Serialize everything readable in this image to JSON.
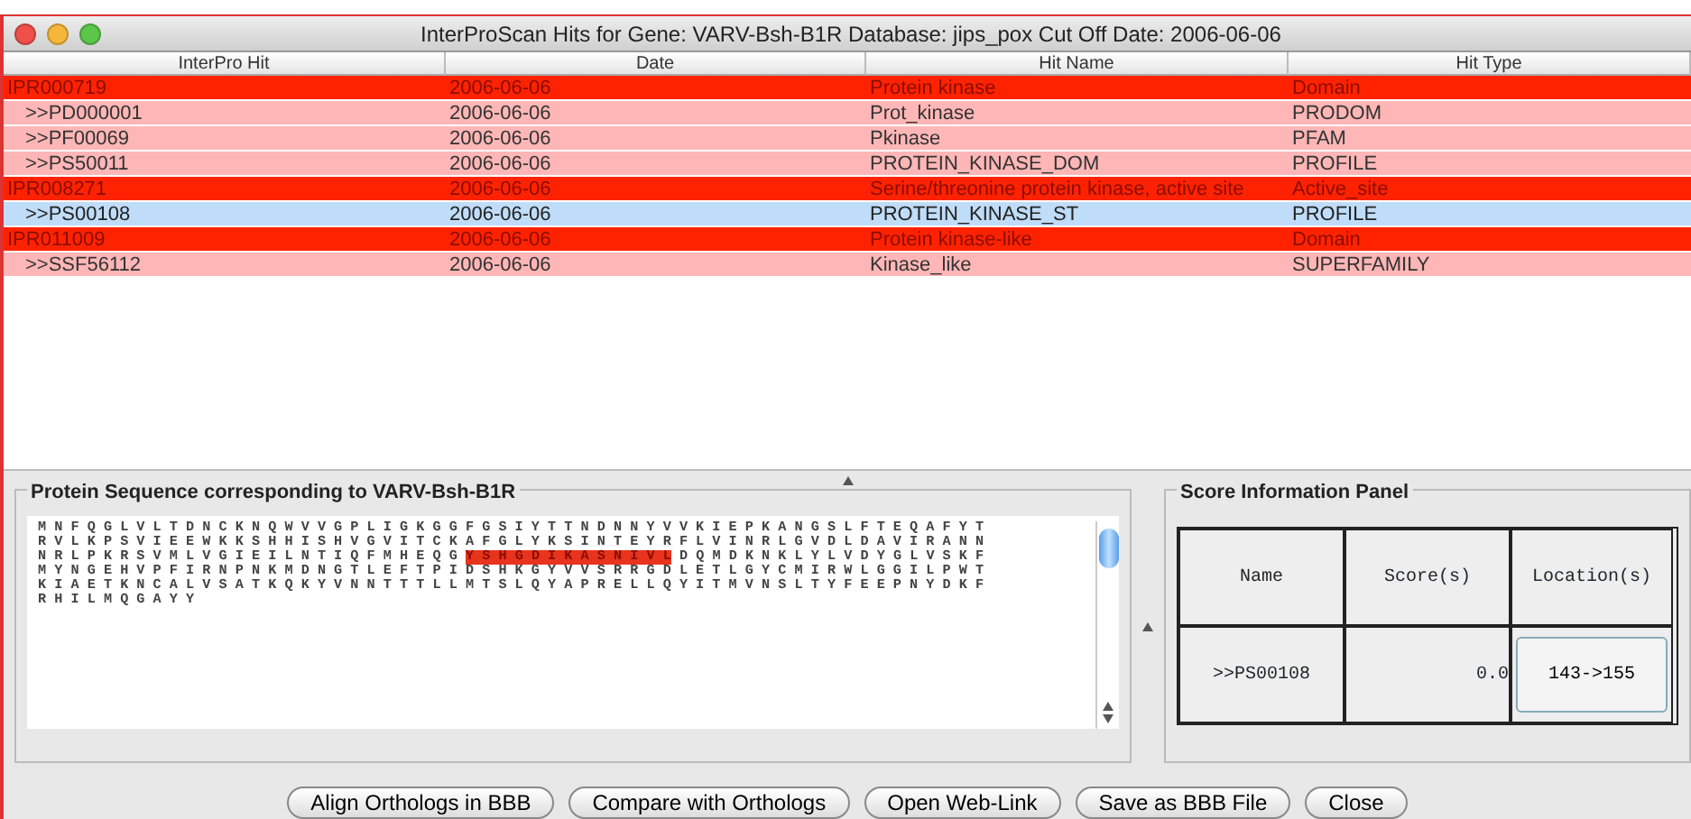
{
  "window": {
    "title": "InterProScan Hits for Gene: VARV-Bsh-B1R Database: jips_pox Cut Off Date: 2006-06-06"
  },
  "table": {
    "columns": [
      "InterPro Hit",
      "Date",
      "Hit Name",
      "Hit Type"
    ],
    "rows": [
      {
        "kind": "entry",
        "selected": false,
        "cells": [
          "IPR000719",
          "2006-06-06",
          "Protein kinase",
          "Domain"
        ]
      },
      {
        "kind": "member",
        "selected": false,
        "cells": [
          ">>PD000001",
          "2006-06-06",
          "Prot_kinase",
          "PRODOM"
        ]
      },
      {
        "kind": "member",
        "selected": false,
        "cells": [
          ">>PF00069",
          "2006-06-06",
          "Pkinase",
          "PFAM"
        ]
      },
      {
        "kind": "member",
        "selected": false,
        "cells": [
          ">>PS50011",
          "2006-06-06",
          "PROTEIN_KINASE_DOM",
          "PROFILE"
        ]
      },
      {
        "kind": "entry",
        "selected": false,
        "cells": [
          "IPR008271",
          "2006-06-06",
          "Serine/threonine protein kinase, active site",
          "Active_site"
        ]
      },
      {
        "kind": "member",
        "selected": true,
        "cells": [
          ">>PS00108",
          "2006-06-06",
          "PROTEIN_KINASE_ST",
          "PROFILE"
        ]
      },
      {
        "kind": "entry",
        "selected": false,
        "cells": [
          "IPR011009",
          "2006-06-06",
          "Protein kinase-like",
          "Domain"
        ]
      },
      {
        "kind": "member",
        "selected": false,
        "cells": [
          ">>SSF56112",
          "2006-06-06",
          "Kinase_like",
          "SUPERFAMILY"
        ]
      }
    ]
  },
  "sequence_panel": {
    "title": "Protein Sequence corresponding to VARV-Bsh-B1R",
    "lines": [
      [
        {
          "text": "M N F Q G L V L T D N C K N Q W V V G P L I G K G G F G S I Y T T N D N N Y V V K I E P K A N G S L F T E Q A F Y T",
          "highlighted": false
        }
      ],
      [
        {
          "text": "R V L K P S V I E E W K K S H H I S H V G V I T C K A F G L Y K S I N T E Y R F L V I N R L G V D L D A V I R A N N",
          "highlighted": false
        }
      ],
      [
        {
          "text": "N R L P K R S V M L V G I E I L N T I Q F M H E Q G",
          "highlighted": false
        },
        {
          "text": "Y S H G D I K A S N I V L",
          "highlighted": true
        },
        {
          "text": "D Q M D K N K L Y L V D Y G L V S K F",
          "highlighted": false
        }
      ],
      [
        {
          "text": "M Y N G E H V P F I R N P N K M D N G T L E F T P I D S H K G Y V V S R R G D L E T L G Y C M I R W L G G I L P W T",
          "highlighted": false
        }
      ],
      [
        {
          "text": "K I A E T K N C A L V S A T K Q K Y V N N T T T L L M T S L Q Y A P R E L L Q Y I T M V N S L T Y F E E P N Y D K F",
          "highlighted": false
        }
      ],
      [
        {
          "text": "R H I L M Q G A Y Y",
          "highlighted": false
        }
      ]
    ]
  },
  "score_panel": {
    "title": "Score Information Panel",
    "columns": [
      "Name",
      "Score(s)",
      "Location(s)"
    ],
    "rows": [
      {
        "name": ">>PS00108",
        "score": "0.0",
        "location": "143->155"
      }
    ]
  },
  "buttons": [
    "Align Orthologs in BBB",
    "Compare with Orthologs",
    "Open Web-Link",
    "Save as BBB File",
    "Close"
  ]
}
